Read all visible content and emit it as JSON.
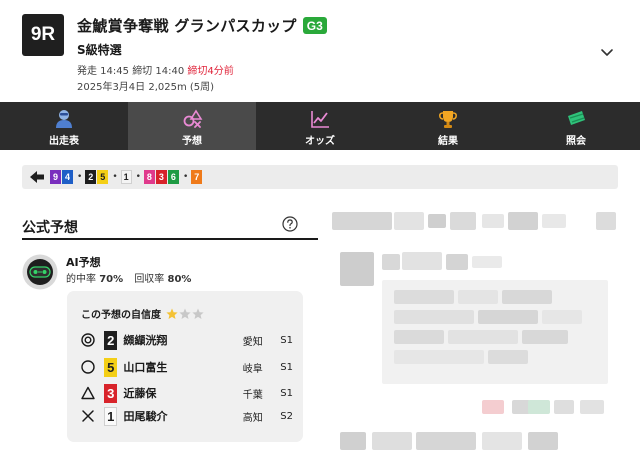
{
  "header": {
    "race_number": "9R",
    "title": "金鯱賞争奪戦 グランパスカップ",
    "grade": "G3",
    "race_class": "S級特選",
    "start_time": "発走 14:45",
    "close_time": "締切 14:40",
    "deadline_text": "締切4分前",
    "date_info": "2025年3月4日 2,025m (5周)",
    "chevron_icon": "chevron-down-icon"
  },
  "nav": {
    "tabs": [
      {
        "label": "出走表",
        "icon": "rider-icon",
        "active": false
      },
      {
        "label": "予想",
        "icon": "prediction-icon",
        "active": true
      },
      {
        "label": "オッズ",
        "icon": "odds-chart-icon",
        "active": false
      },
      {
        "label": "結果",
        "icon": "trophy-icon",
        "active": false
      },
      {
        "label": "照会",
        "icon": "ticket-icon",
        "active": false
      }
    ]
  },
  "result_strip": {
    "arrow_icon": "arrow-left-icon",
    "groups": [
      {
        "numbers": [
          {
            "n": "9",
            "bg": "#7a2fbe",
            "fg": "#ffffff"
          },
          {
            "n": "4",
            "bg": "#1f5fc7",
            "fg": "#ffffff"
          }
        ]
      },
      {
        "numbers": [
          {
            "n": "2",
            "bg": "#1f1f1f",
            "fg": "#ffffff"
          },
          {
            "n": "5",
            "bg": "#f4cf16",
            "fg": "#1f1f1f"
          }
        ]
      },
      {
        "numbers": [
          {
            "n": "1",
            "bg": "#f4f4f4",
            "fg": "#1f1f1f"
          }
        ]
      },
      {
        "numbers": [
          {
            "n": "8",
            "bg": "#e03a8c",
            "fg": "#ffffff"
          },
          {
            "n": "3",
            "bg": "#d8232a",
            "fg": "#ffffff"
          },
          {
            "n": "6",
            "bg": "#1f9b44",
            "fg": "#ffffff"
          }
        ]
      },
      {
        "numbers": [
          {
            "n": "7",
            "bg": "#ef7a1a",
            "fg": "#ffffff"
          }
        ]
      }
    ]
  },
  "official": {
    "title": "公式予想",
    "help_icon": "question-circle-icon",
    "ai_name": "AI予想",
    "hit_rate_label": "的中率",
    "hit_rate": "70%",
    "return_rate_label": "回収率",
    "return_rate": "80%",
    "confidence_label": "この予想の自信度",
    "confidence_stars": 1,
    "confidence_max": 3,
    "picks": [
      {
        "mark": "double-circle-icon",
        "num": "2",
        "bg": "#1f1f1f",
        "fg": "#ffffff",
        "name": "纐纈洸翔",
        "pref": "愛知",
        "cls": "S1"
      },
      {
        "mark": "circle-icon",
        "num": "5",
        "bg": "#f4cf16",
        "fg": "#1f1f1f",
        "name": "山口富生",
        "pref": "岐阜",
        "cls": "S1"
      },
      {
        "mark": "triangle-icon",
        "num": "3",
        "bg": "#d8232a",
        "fg": "#ffffff",
        "name": "近藤保",
        "pref": "千葉",
        "cls": "S1"
      },
      {
        "mark": "cross-icon",
        "num": "1",
        "bg": "#fafafa",
        "fg": "#1f1f1f",
        "name": "田尾駿介",
        "pref": "高知",
        "cls": "S2"
      }
    ]
  },
  "colors": {
    "nav_bg": "#2c2c2c",
    "nav_active": "#4a4a4a",
    "deadline_red": "#e0243a",
    "grade_green": "#2aa93a",
    "star_gold": "#f4c235",
    "star_grey": "#c8c8c8"
  }
}
